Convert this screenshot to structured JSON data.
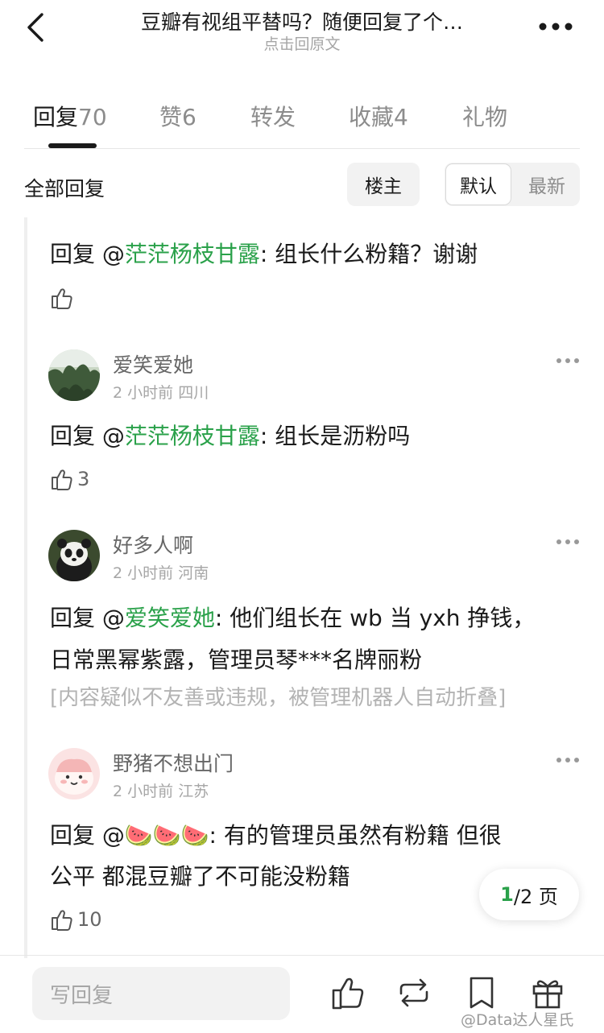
{
  "header": {
    "title": "豆瓣有视组平替吗？随便回复了个…",
    "subtitle": "点击回原文",
    "back_icon": "chevron-left-icon",
    "more_icon": "more-horizontal-icon"
  },
  "tabs": [
    {
      "label": "回复",
      "count": "70"
    },
    {
      "label": "赞",
      "count": "6"
    },
    {
      "label": "转发",
      "count": ""
    },
    {
      "label": "收藏",
      "count": "4"
    },
    {
      "label": "礼物",
      "count": ""
    }
  ],
  "filter": {
    "all_replies": "全部回复",
    "op_button": "楼主",
    "sort_default": "默认",
    "sort_latest": "最新"
  },
  "replies": [
    {
      "prefix": "回复 @",
      "mention": "茫茫杨枝甘露",
      "text": ": 组长什么粉籍？谢谢",
      "likes": ""
    },
    {
      "user": "爱笑爱她",
      "time": "2 小时前",
      "location": "四川",
      "prefix": "回复 @",
      "mention": "茫茫杨枝甘露",
      "text": ": 组长是沥粉吗",
      "likes": "3"
    },
    {
      "user": "好多人啊",
      "time": "2 小时前",
      "location": "河南",
      "prefix": "回复 @",
      "mention": "爱笑爱她",
      "text": ": 他们组长在 wb 当 yxh 挣钱，",
      "text2": "日常黑幂紫露，管理员琴***名牌丽粉",
      "folded": "[内容疑似不友善或违规，被管理机器人自动折叠]"
    },
    {
      "user": "野猪不想出门",
      "time": "2 小时前",
      "location": "江苏",
      "prefix": "回复 @",
      "mention": "🍉🍉🍉",
      "text": ": 有的管理员虽然有粉籍 但很",
      "text2": "公平 都混豆瓣了不可能没粉籍",
      "likes": "10"
    }
  ],
  "pager": {
    "current": "1",
    "total": "/2 页"
  },
  "bottom": {
    "reply_placeholder": "写回复",
    "icons": [
      "like-icon",
      "repost-icon",
      "bookmark-icon",
      "gift-icon"
    ]
  },
  "watermark": "@Data达人星氏",
  "colors": {
    "accent_green": "#2aa14a",
    "muted": "#a6a6a6"
  }
}
